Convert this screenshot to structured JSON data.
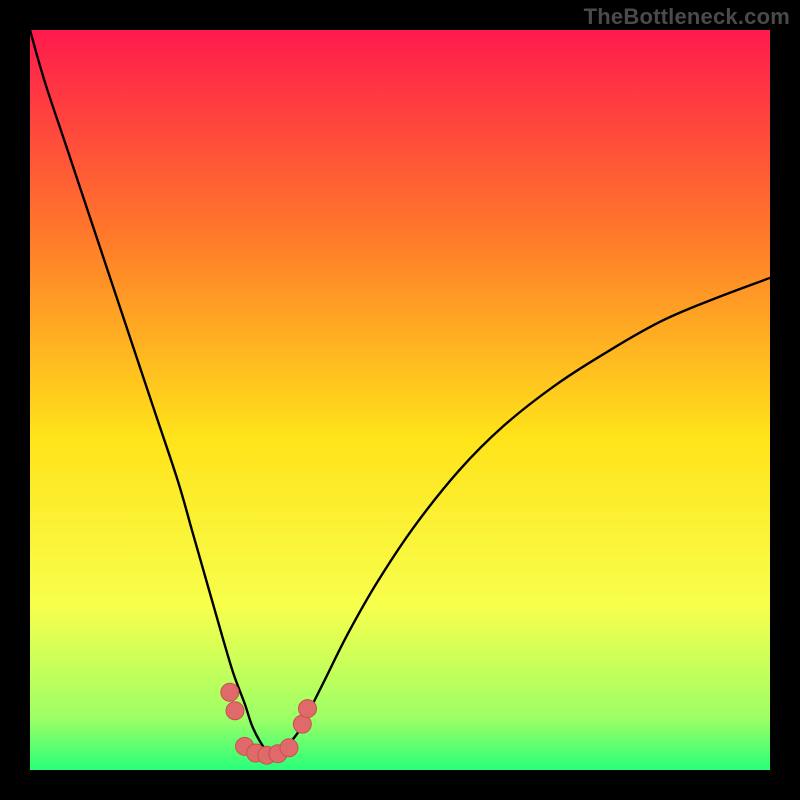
{
  "watermark": "TheBottleneck.com",
  "colors": {
    "bg_black": "#000000",
    "grad_top": "#ff1a4d",
    "grad_mid1": "#ff7a2a",
    "grad_mid2": "#ffe31a",
    "grad_low1": "#f7ff4d",
    "grad_low2": "#9dff66",
    "grad_bottom": "#28ff7a",
    "curve": "#000000",
    "marker_fill": "#e06a6a",
    "marker_stroke": "#c94f4f"
  },
  "chart_data": {
    "type": "line",
    "title": "",
    "xlabel": "",
    "ylabel": "",
    "xlim": [
      0,
      100
    ],
    "ylim": [
      0,
      100
    ],
    "series": [
      {
        "name": "left-branch",
        "x": [
          0,
          2,
          5,
          8,
          11,
          14,
          17,
          20,
          22,
          24,
          26,
          27.5,
          29,
          30,
          31,
          32,
          33
        ],
        "y": [
          100,
          93,
          84,
          75,
          66,
          57,
          48,
          39,
          32,
          25,
          18,
          13,
          9,
          6,
          4,
          2.5,
          1.7
        ]
      },
      {
        "name": "right-branch",
        "x": [
          33,
          34,
          35,
          36.5,
          38,
          40,
          43,
          47,
          52,
          58,
          64,
          71,
          78,
          85,
          92,
          100
        ],
        "y": [
          1.7,
          2.2,
          3.5,
          5.5,
          8.5,
          12.5,
          18.5,
          25.5,
          33,
          40.5,
          46.5,
          52,
          56.5,
          60.5,
          63.5,
          66.5
        ]
      }
    ],
    "markers": [
      {
        "x": 27.0,
        "y": 10.5
      },
      {
        "x": 27.7,
        "y": 8.0
      },
      {
        "x": 29.0,
        "y": 3.2
      },
      {
        "x": 30.5,
        "y": 2.3
      },
      {
        "x": 32.0,
        "y": 2.0
      },
      {
        "x": 33.5,
        "y": 2.2
      },
      {
        "x": 35.0,
        "y": 3.0
      },
      {
        "x": 36.8,
        "y": 6.2
      },
      {
        "x": 37.5,
        "y": 8.3
      }
    ]
  }
}
